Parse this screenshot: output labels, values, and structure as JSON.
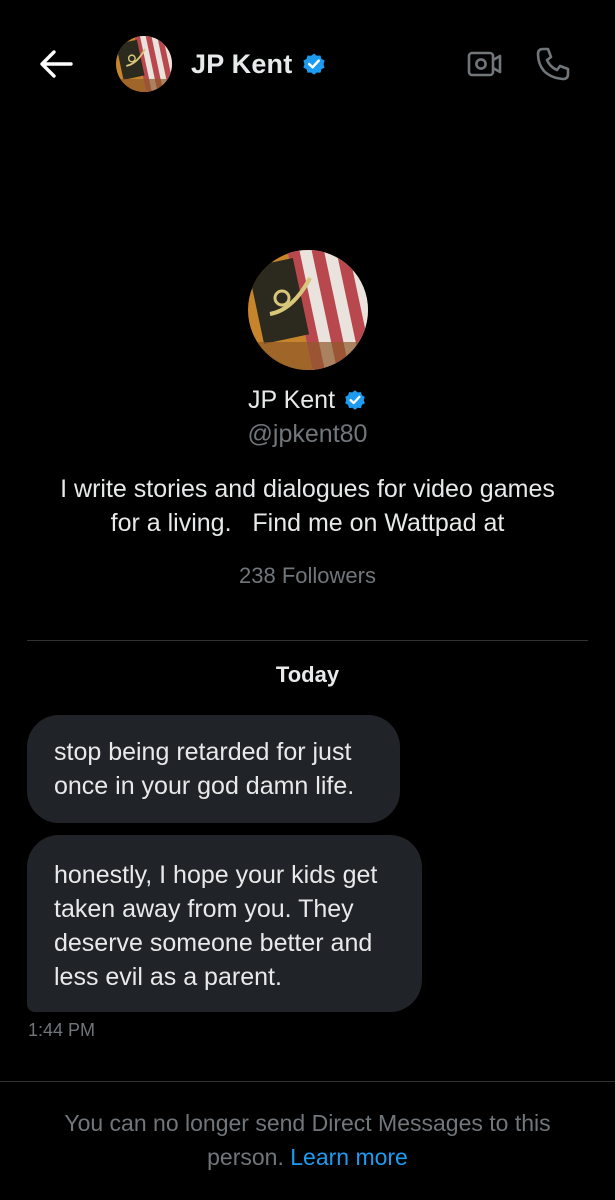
{
  "header": {
    "name": "JP Kent",
    "back_icon": "back-arrow-icon",
    "video_icon": "video-camera-icon",
    "call_icon": "phone-icon",
    "verified_icon": "verified-badge-icon"
  },
  "profile": {
    "name": "JP Kent",
    "handle": "@jpkent80",
    "bio": "I write stories and dialogues for video games for a living.   Find me on Wattpad at",
    "followers": "238 Followers"
  },
  "conversation": {
    "date_label": "Today",
    "messages": [
      {
        "text": "stop being retarded for just once in your god damn life."
      },
      {
        "text": "honestly, I hope your kids get taken away from you. They deserve someone better and less evil as a parent."
      }
    ],
    "timestamp": "1:44 PM"
  },
  "footer": {
    "notice": "You can no longer send Direct Messages to this person.",
    "learn_more": "Learn more"
  },
  "colors": {
    "background": "#000000",
    "text_primary": "#e7e9ea",
    "text_secondary": "#71767b",
    "bubble": "#202327",
    "accent": "#1d9bf0",
    "divider": "#2f3336"
  }
}
